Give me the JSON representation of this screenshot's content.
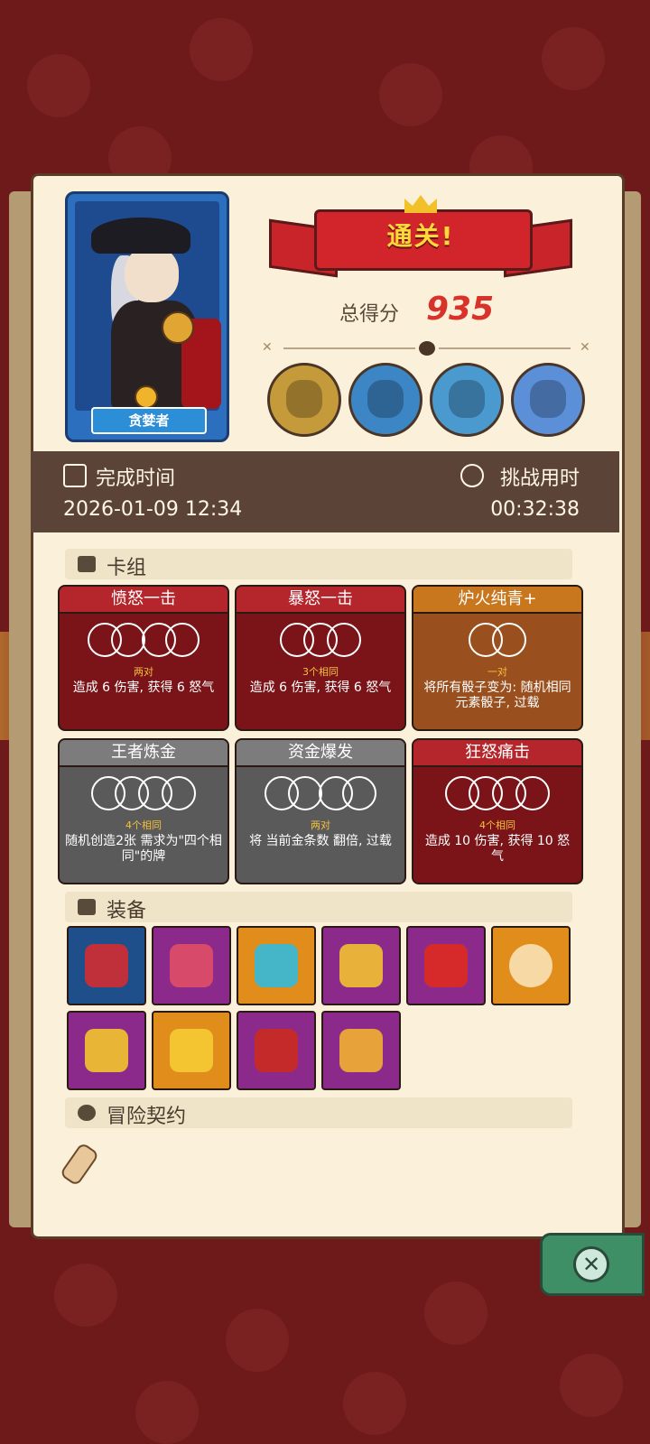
{
  "result": {
    "title": "通关!",
    "score_label": "总得分",
    "score_value": "935"
  },
  "character": {
    "name": "贪婪者"
  },
  "time": {
    "finish_label": "完成时间",
    "finish_value": "2026-01-09 12:34",
    "challenge_label": "挑战用时",
    "challenge_value": "00:32:38"
  },
  "sections": {
    "deck": "卡组",
    "equipment": "装备",
    "contract": "冒险契约"
  },
  "cards": [
    {
      "name": "愤怒一击",
      "req": "两对",
      "desc": "造成 6 伤害, 获得 6 怒气",
      "style": "red"
    },
    {
      "name": "暴怒一击",
      "req": "3个相同",
      "desc": "造成 6 伤害, 获得 6 怒气",
      "style": "red"
    },
    {
      "name": "炉火纯青+",
      "req": "一对",
      "desc": "将所有骰子变为: 随机相同元素骰子, 过载",
      "style": "orange"
    },
    {
      "name": "王者炼金",
      "req": "4个相同",
      "desc": "随机创造2张 需求为\"四个相同\"的牌",
      "style": "grey"
    },
    {
      "name": "资金爆发",
      "req": "两对",
      "desc": "将 当前金条数 翻倍, 过载",
      "style": "grey"
    },
    {
      "name": "狂怒痛击",
      "req": "4个相同",
      "desc": "造成 10 伤害, 获得 10 怒气",
      "style": "red"
    }
  ],
  "equipment": [
    {
      "icon": "ruby-scepter-icon",
      "color": "#1f4f8a"
    },
    {
      "icon": "jelly-monster-icon",
      "color": "#8c2a8c"
    },
    {
      "icon": "spirit-flame-icon",
      "color": "#e08d1c"
    },
    {
      "icon": "golden-ruler-icon",
      "color": "#8c2a8c"
    },
    {
      "icon": "red-gauntlet-icon",
      "color": "#8c2a8c"
    },
    {
      "icon": "ring-coin-icon",
      "color": "#e08d1c"
    },
    {
      "icon": "treasure-chest-icon",
      "color": "#8c2a8c"
    },
    {
      "icon": "golden-crown-icon",
      "color": "#e08d1c"
    },
    {
      "icon": "spiked-bracelet-icon",
      "color": "#8c2a8c"
    },
    {
      "icon": "golden-glove-icon",
      "color": "#8c2a8c"
    }
  ],
  "bosses": [
    "red-cyclops-boss",
    "spider-boss",
    "fish-boss",
    "skull-king-boss"
  ]
}
